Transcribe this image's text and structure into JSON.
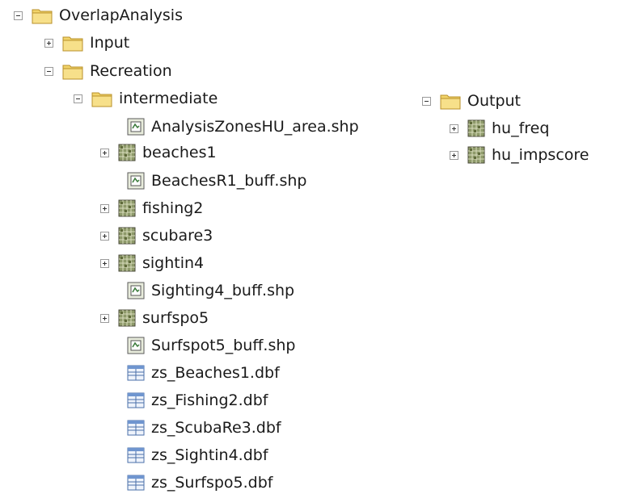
{
  "tree": {
    "root": {
      "label": "OverlapAnalysis",
      "icon": "folder-icon",
      "expanded": true
    },
    "input": {
      "label": "Input",
      "icon": "folder-icon",
      "expanded": false
    },
    "recreation": {
      "label": "Recreation",
      "icon": "folder-icon",
      "expanded": true
    },
    "intermediate": {
      "label": "intermediate",
      "icon": "folder-icon",
      "expanded": true
    },
    "intermediate_items": [
      {
        "label": "AnalysisZonesHU_area.shp",
        "icon": "shapefile-icon",
        "toggle": false
      },
      {
        "label": "beaches1",
        "icon": "raster-icon",
        "toggle": true
      },
      {
        "label": "BeachesR1_buff.shp",
        "icon": "shapefile-icon",
        "toggle": false
      },
      {
        "label": "fishing2",
        "icon": "raster-icon",
        "toggle": true
      },
      {
        "label": "scubare3",
        "icon": "raster-icon",
        "toggle": true
      },
      {
        "label": "sightin4",
        "icon": "raster-icon",
        "toggle": true
      },
      {
        "label": "Sighting4_buff.shp",
        "icon": "shapefile-icon",
        "toggle": false
      },
      {
        "label": "surfspo5",
        "icon": "raster-icon",
        "toggle": true
      },
      {
        "label": "Surfspot5_buff.shp",
        "icon": "shapefile-icon",
        "toggle": false
      },
      {
        "label": "zs_Beaches1.dbf",
        "icon": "table-icon",
        "toggle": false
      },
      {
        "label": "zs_Fishing2.dbf",
        "icon": "table-icon",
        "toggle": false
      },
      {
        "label": "zs_ScubaRe3.dbf",
        "icon": "table-icon",
        "toggle": false
      },
      {
        "label": "zs_Sightin4.dbf",
        "icon": "table-icon",
        "toggle": false
      },
      {
        "label": "zs_Surfspo5.dbf",
        "icon": "table-icon",
        "toggle": false
      }
    ],
    "output": {
      "label": "Output",
      "icon": "folder-icon",
      "expanded": true
    },
    "output_items": [
      {
        "label": "hu_freq",
        "icon": "raster-icon",
        "toggle": true
      },
      {
        "label": "hu_impscore",
        "icon": "raster-icon",
        "toggle": true
      }
    ]
  },
  "colors": {
    "folder": "#f2d46a",
    "text": "#1a1a1a",
    "toggle_border": "#9a9a9a"
  }
}
